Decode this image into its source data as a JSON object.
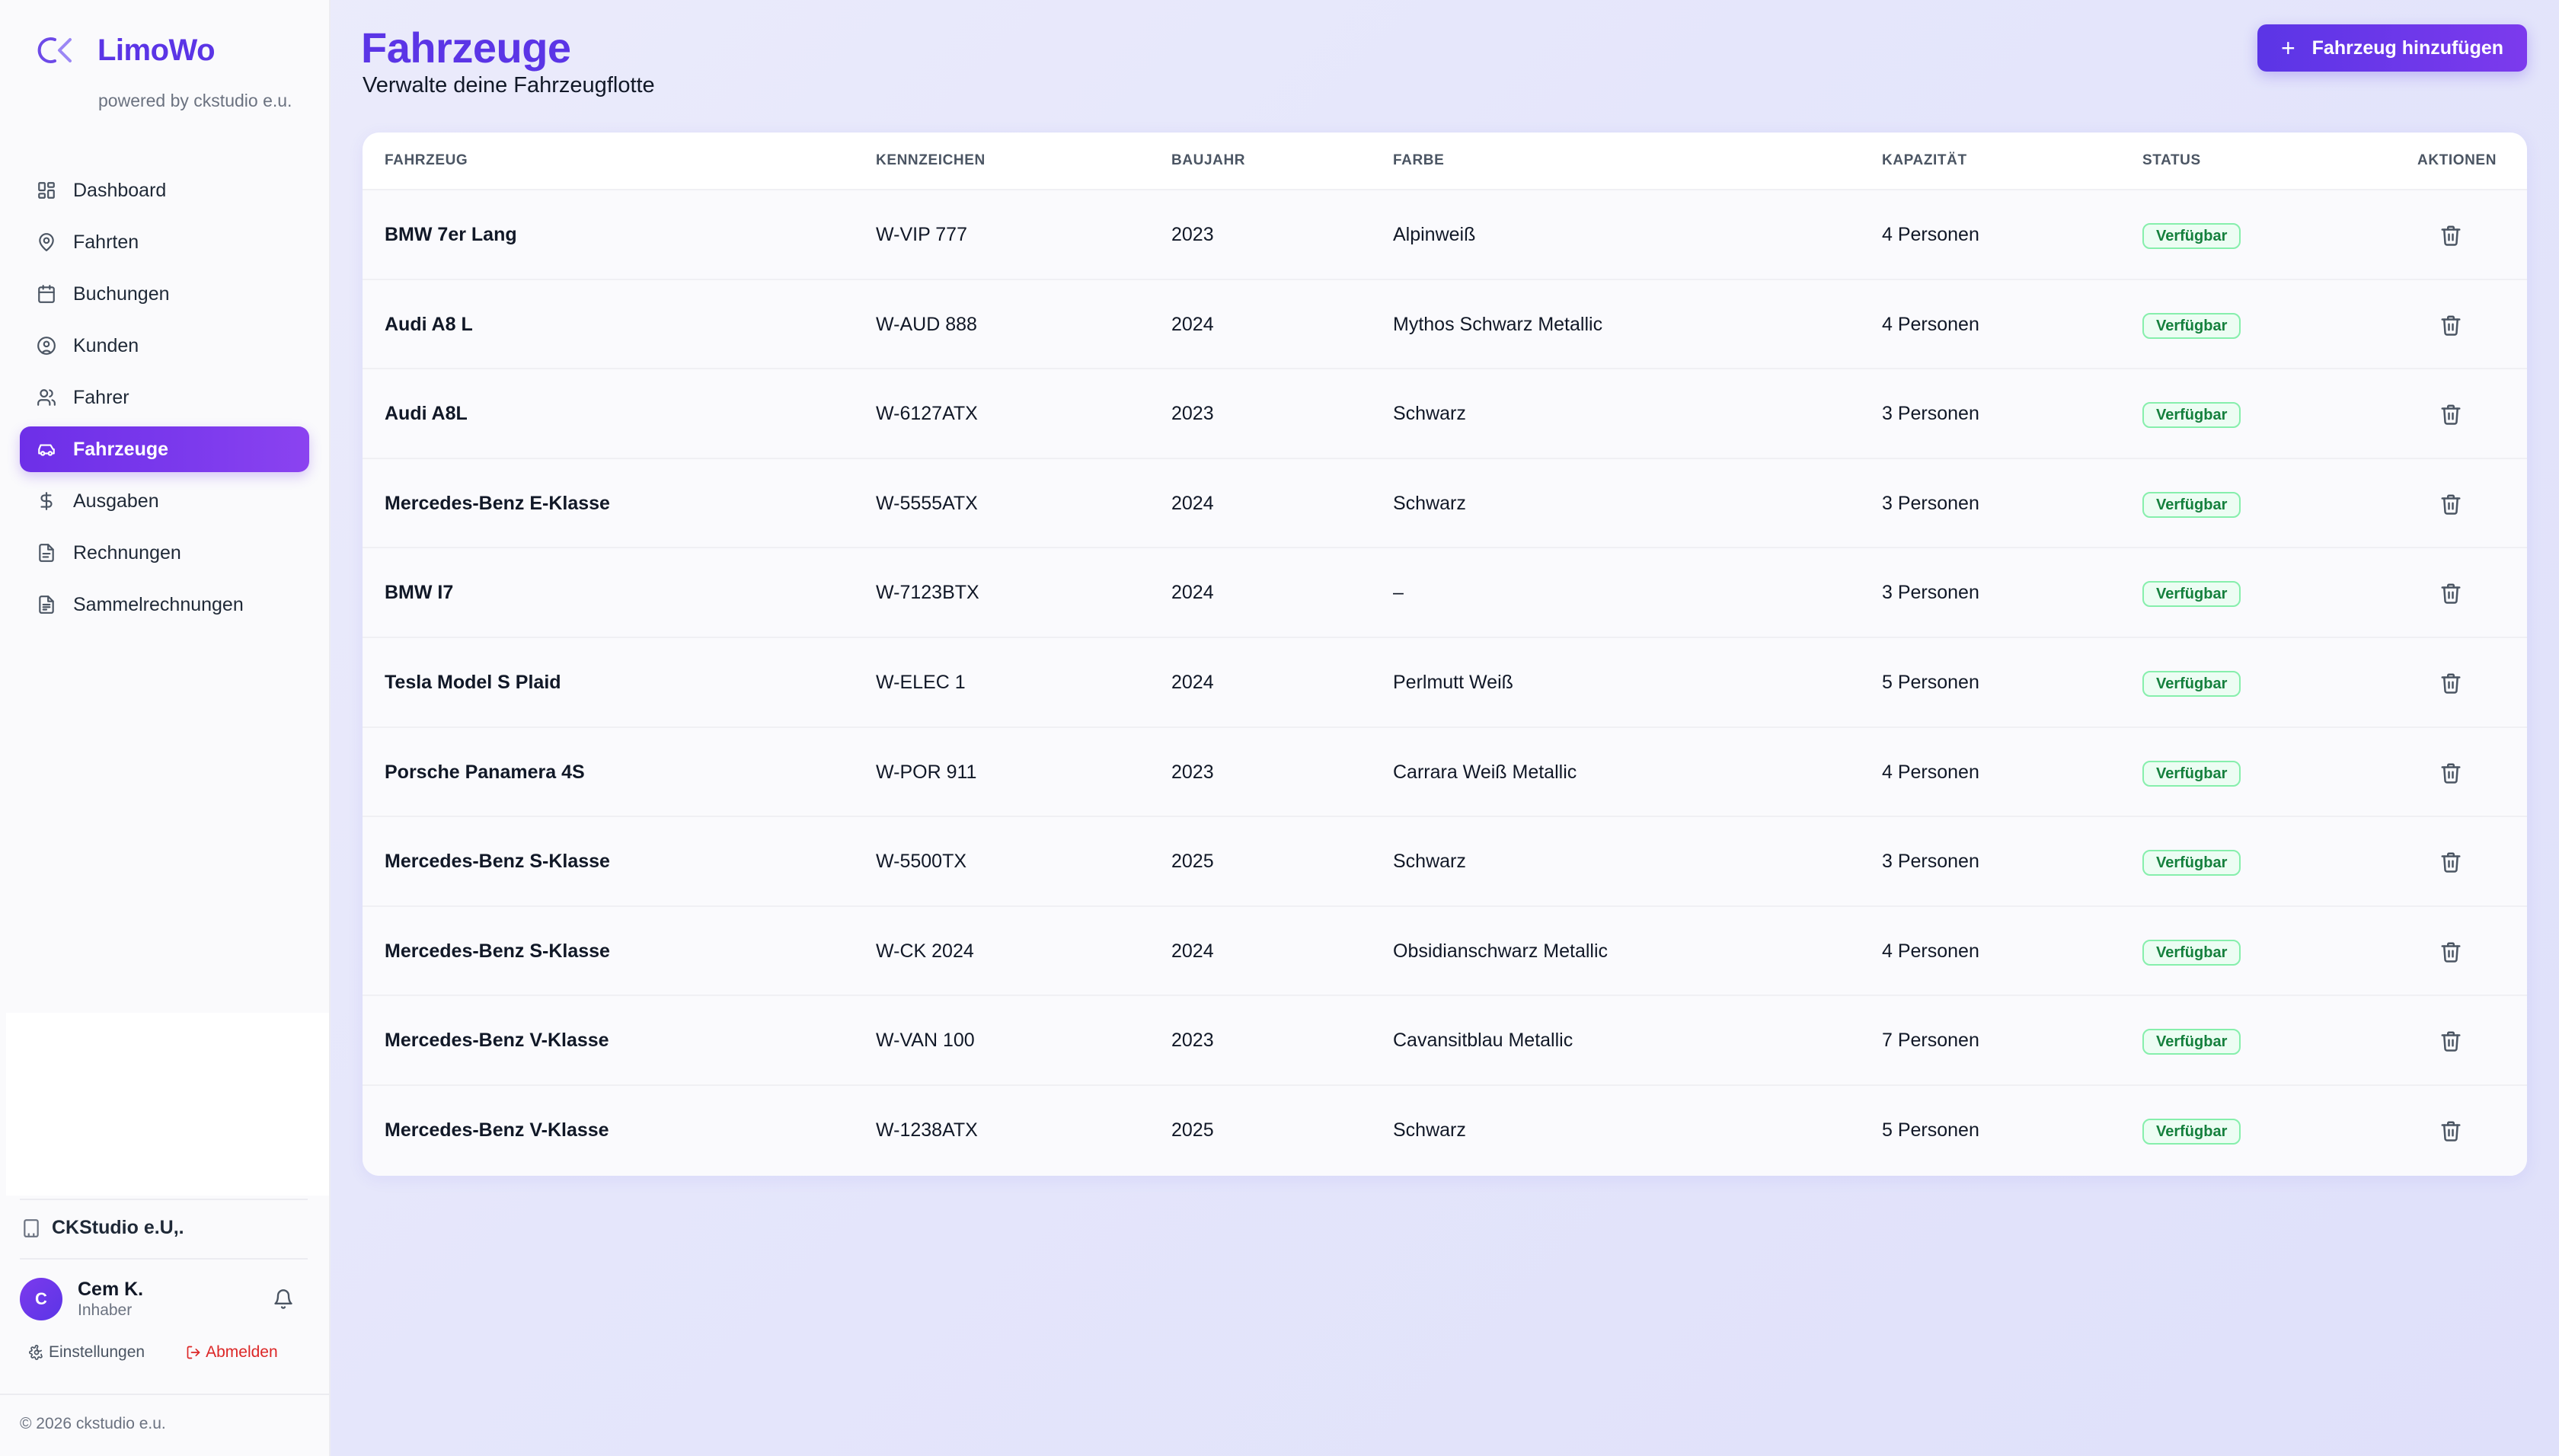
{
  "brand": {
    "name": "LimoWo",
    "subtitle": "powered by ckstudio e.u."
  },
  "sidebar": {
    "items": [
      {
        "label": "Dashboard",
        "icon": "dashboard-icon",
        "active": false
      },
      {
        "label": "Fahrten",
        "icon": "map-pin-icon",
        "active": false
      },
      {
        "label": "Buchungen",
        "icon": "calendar-icon",
        "active": false
      },
      {
        "label": "Kunden",
        "icon": "user-circle-icon",
        "active": false
      },
      {
        "label": "Fahrer",
        "icon": "users-icon",
        "active": false
      },
      {
        "label": "Fahrzeuge",
        "icon": "car-icon",
        "active": true
      },
      {
        "label": "Ausgaben",
        "icon": "dollar-icon",
        "active": false
      },
      {
        "label": "Rechnungen",
        "icon": "file-icon",
        "active": false
      },
      {
        "label": "Sammelrechnungen",
        "icon": "file-stack-icon",
        "active": false
      }
    ],
    "organization": "CKStudio e.U,.",
    "user": {
      "initial": "C",
      "name": "Cem K.",
      "role": "Inhaber"
    },
    "settings_label": "Einstellungen",
    "logout_label": "Abmelden",
    "copyright": "© 2026 ckstudio e.u."
  },
  "header": {
    "title": "Fahrzeuge",
    "subtitle": "Verwalte deine Fahrzeugflotte",
    "add_button_label": "Fahrzeug hinzufügen"
  },
  "table": {
    "columns": [
      "FAHRZEUG",
      "KENNZEICHEN",
      "BAUJAHR",
      "FARBE",
      "KAPAZITÄT",
      "STATUS",
      "AKTIONEN"
    ],
    "rows": [
      {
        "vehicle": "BMW 7er Lang",
        "plate": "W-VIP 777",
        "year": "2023",
        "color": "Alpinweiß",
        "capacity": "4 Personen",
        "status": "Verfügbar"
      },
      {
        "vehicle": "Audi A8 L",
        "plate": "W-AUD 888",
        "year": "2024",
        "color": "Mythos Schwarz Metallic",
        "capacity": "4 Personen",
        "status": "Verfügbar"
      },
      {
        "vehicle": "Audi A8L",
        "plate": "W-6127ATX",
        "year": "2023",
        "color": "Schwarz",
        "capacity": "3 Personen",
        "status": "Verfügbar"
      },
      {
        "vehicle": "Mercedes-Benz E-Klasse",
        "plate": "W-5555ATX",
        "year": "2024",
        "color": "Schwarz",
        "capacity": "3 Personen",
        "status": "Verfügbar"
      },
      {
        "vehicle": "BMW I7",
        "plate": "W-7123BTX",
        "year": "2024",
        "color": "–",
        "capacity": "3 Personen",
        "status": "Verfügbar"
      },
      {
        "vehicle": "Tesla Model S Plaid",
        "plate": "W-ELEC 1",
        "year": "2024",
        "color": "Perlmutt Weiß",
        "capacity": "5 Personen",
        "status": "Verfügbar"
      },
      {
        "vehicle": "Porsche Panamera 4S",
        "plate": "W-POR 911",
        "year": "2023",
        "color": "Carrara Weiß Metallic",
        "capacity": "4 Personen",
        "status": "Verfügbar"
      },
      {
        "vehicle": "Mercedes-Benz S-Klasse",
        "plate": "W-5500TX",
        "year": "2025",
        "color": "Schwarz",
        "capacity": "3 Personen",
        "status": "Verfügbar"
      },
      {
        "vehicle": "Mercedes-Benz S-Klasse",
        "plate": "W-CK 2024",
        "year": "2024",
        "color": "Obsidianschwarz Metallic",
        "capacity": "4 Personen",
        "status": "Verfügbar"
      },
      {
        "vehicle": "Mercedes-Benz V-Klasse",
        "plate": "W-VAN 100",
        "year": "2023",
        "color": "Cavansitblau Metallic",
        "capacity": "7 Personen",
        "status": "Verfügbar"
      },
      {
        "vehicle": "Mercedes-Benz V-Klasse",
        "plate": "W-1238ATX",
        "year": "2025",
        "color": "Schwarz",
        "capacity": "5 Personen",
        "status": "Verfügbar"
      }
    ]
  },
  "colors": {
    "accent": "#5b35e6",
    "accent_light": "#7c3aed",
    "status_ok": "#15803d",
    "danger": "#dc2626"
  }
}
